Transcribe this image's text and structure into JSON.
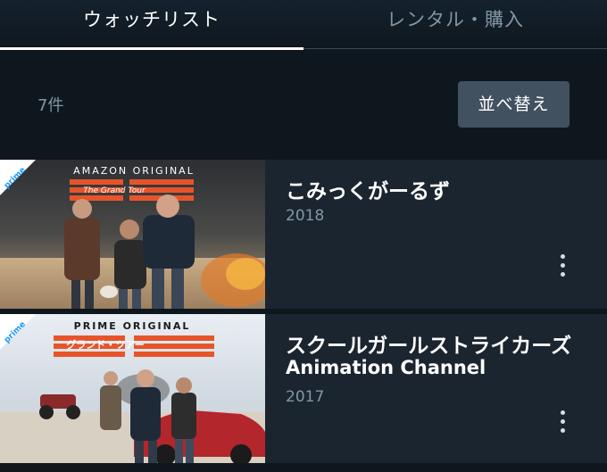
{
  "tabs": [
    {
      "label": "ウォッチリスト",
      "active": true
    },
    {
      "label": "レンタル・購入",
      "active": false
    }
  ],
  "list": {
    "count_label": "7件",
    "sort_label": "並べ替え"
  },
  "items": [
    {
      "title": "こみっくがーるず",
      "subtitle": "",
      "year": "2018",
      "thumb_banner": "AMAZON ORIGINAL",
      "thumb_logo_text": "The Grand Tour",
      "prime_badge": "prime"
    },
    {
      "title": "スクールガールストライカーズ",
      "subtitle": "Animation Channel",
      "year": "2017",
      "thumb_banner": "PRIME ORIGINAL",
      "thumb_logo_text": "グランド・ツアー",
      "prime_badge": "prime"
    }
  ],
  "colors": {
    "background": "#0f171e",
    "row": "#1b2530",
    "muted_text": "#8197a4",
    "button": "#425160",
    "prime_blue": "#1a98ff",
    "logo_orange": "#e8542a"
  }
}
